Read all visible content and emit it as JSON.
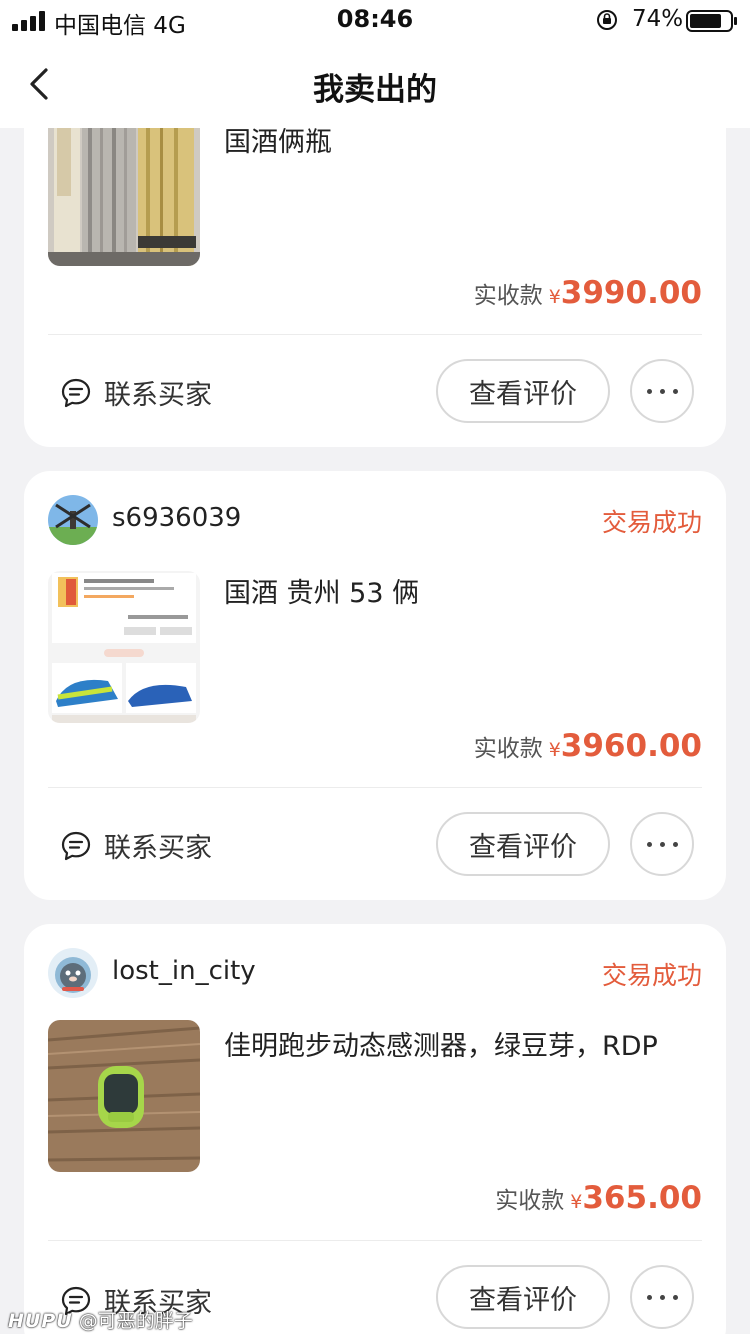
{
  "status_bar": {
    "carrier": "中国电信  4G",
    "time": "08:46",
    "battery": "74%"
  },
  "nav": {
    "title": "我卖出的"
  },
  "orders": [
    {
      "title": "国酒俩瓶",
      "amount_label": "实收款",
      "currency": "¥",
      "amount": "3990.00",
      "contact_label": "联系买家",
      "review_label": "查看评价"
    },
    {
      "username": "s6936039",
      "status": "交易成功",
      "title": "国酒 贵州 53 俩",
      "amount_label": "实收款",
      "currency": "¥",
      "amount": "3960.00",
      "contact_label": "联系买家",
      "review_label": "查看评价"
    },
    {
      "username": "lost_in_city",
      "status": "交易成功",
      "title": "佳明跑步动态感测器，绿豆芽，RDP",
      "amount_label": "实收款",
      "currency": "¥",
      "amount": "365.00",
      "contact_label": "联系买家",
      "review_label": "查看评价"
    }
  ],
  "watermark": {
    "brand": "HUPU",
    "text": "@可恶的胖子"
  },
  "colors": {
    "accent": "#e35c3c",
    "background": "#f2f2f4"
  },
  "icons": [
    "signal-icon",
    "rotation-lock-icon",
    "battery-icon",
    "back-arrow-icon",
    "chat-bubble-icon",
    "more-dots-icon"
  ]
}
